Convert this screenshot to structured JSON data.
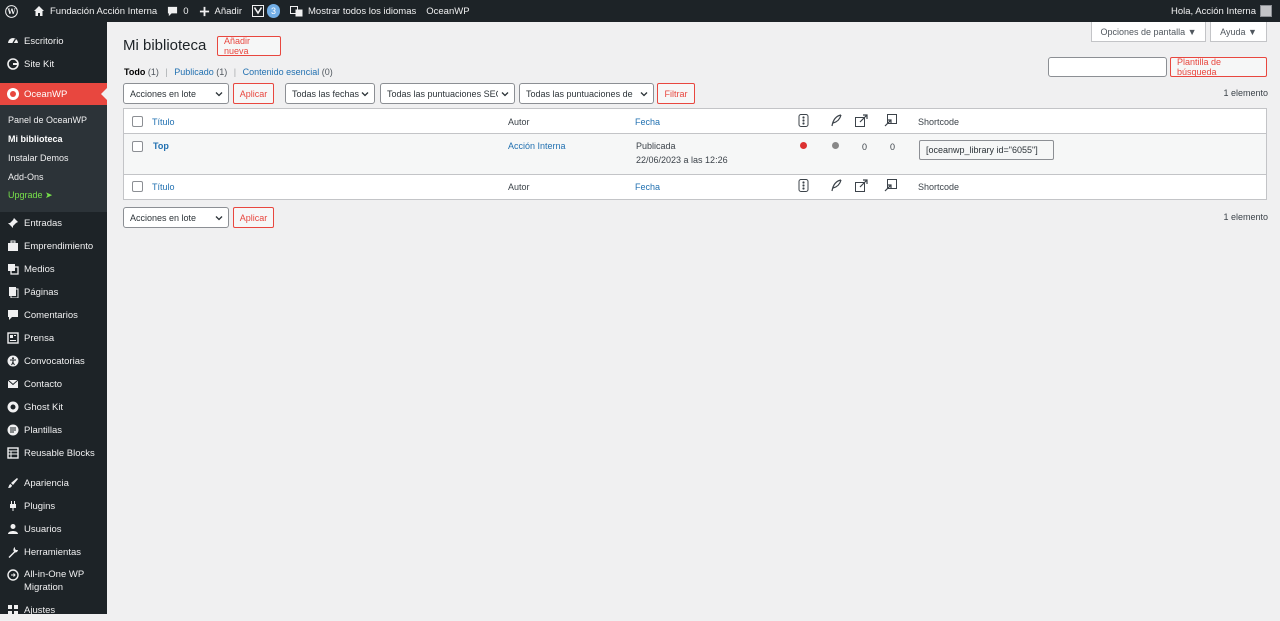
{
  "admin_bar": {
    "site_name": "Fundación Acción Interna",
    "comments_count": "0",
    "add_new": "Añadir",
    "yoast_badge": "3",
    "languages": "Mostrar todos los idiomas",
    "oceanwp": "OceanWP",
    "greeting": "Hola, Acción Interna"
  },
  "sidebar": {
    "items_top": [
      {
        "label": "Escritorio",
        "icon": "dashboard-icon"
      },
      {
        "label": "Site Kit",
        "icon": "sitekit-icon"
      }
    ],
    "active": {
      "label": "OceanWP",
      "icon": "oceanwp-icon"
    },
    "submenu": [
      "Panel de OceanWP",
      "Mi biblioteca",
      "Instalar Demos",
      "Add-Ons",
      "Upgrade"
    ],
    "items": [
      {
        "label": "Entradas",
        "icon": "pin-icon"
      },
      {
        "label": "Emprendimiento",
        "icon": "briefcase-icon"
      },
      {
        "label": "Medios",
        "icon": "media-icon"
      },
      {
        "label": "Páginas",
        "icon": "pages-icon"
      },
      {
        "label": "Comentarios",
        "icon": "comments-icon"
      },
      {
        "label": "Prensa",
        "icon": "press-icon"
      },
      {
        "label": "Convocatorias",
        "icon": "accessibility-icon"
      },
      {
        "label": "Contacto",
        "icon": "mail-icon"
      },
      {
        "label": "Ghost Kit",
        "icon": "ghost-icon"
      },
      {
        "label": "Plantillas",
        "icon": "templates-icon"
      },
      {
        "label": "Reusable Blocks",
        "icon": "blocks-icon"
      },
      {
        "label": "Apariencia",
        "icon": "brush-icon"
      },
      {
        "label": "Plugins",
        "icon": "plugin-icon"
      },
      {
        "label": "Usuarios",
        "icon": "users-icon"
      },
      {
        "label": "Herramientas",
        "icon": "wrench-icon"
      },
      {
        "label": "All-in-One WP",
        "label2": "Migration",
        "icon": "migration-icon"
      },
      {
        "label": "Ajustes",
        "icon": "settings-icon"
      }
    ]
  },
  "screen_options": "Opciones de pantalla ▼",
  "help": "Ayuda ▼",
  "page": {
    "title": "Mi biblioteca",
    "add_new": "Añadir nueva"
  },
  "views": {
    "all": "Todo",
    "all_count": "(1)",
    "published": "Publicado",
    "published_count": "(1)",
    "cornerstone": "Contenido esencial",
    "cornerstone_count": "(0)"
  },
  "search": {
    "button": "Plantilla de búsqueda",
    "value": ""
  },
  "filters": {
    "bulk_actions": "Acciones en lote",
    "apply": "Aplicar",
    "dates": "Todas las fechas",
    "seo_scores": "Todas las puntuaciones SEO",
    "readability_scores": "Todas las puntuaciones de",
    "filter": "Filtrar",
    "count": "1 elemento"
  },
  "table": {
    "headers": {
      "title": "Título",
      "author": "Autor",
      "date": "Fecha",
      "shortcode": "Shortcode"
    },
    "rows": [
      {
        "title": "Top",
        "author": "Acción Interna",
        "status": "Publicada",
        "date": "22/06/2023 a las 12:26",
        "seo_color": "#dc3232",
        "readability_color": "#888888",
        "links_out": "0",
        "links_in": "0",
        "shortcode": "[oceanwp_library id=\"6055\"]"
      }
    ]
  },
  "bottom": {
    "bulk_actions": "Acciones en lote",
    "apply": "Aplicar",
    "count": "1 elemento"
  }
}
